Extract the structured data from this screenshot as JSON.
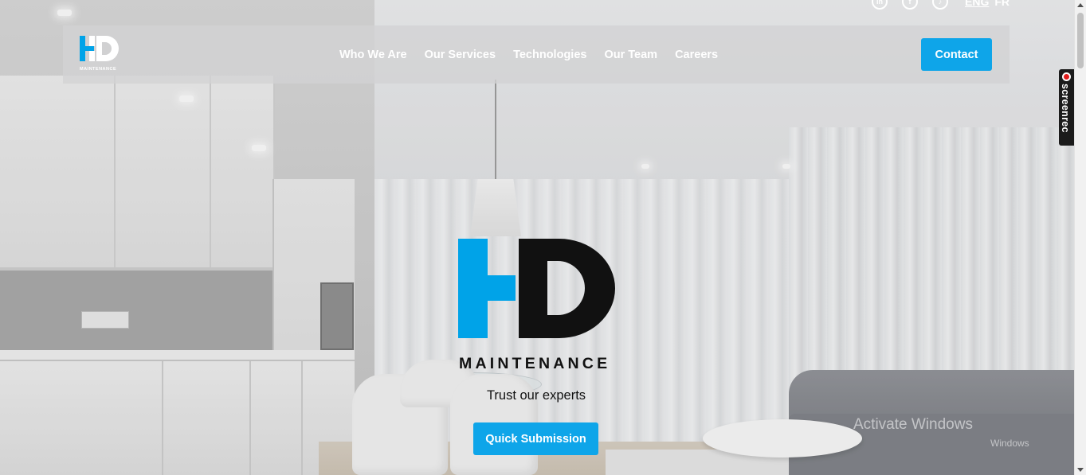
{
  "brand": {
    "name": "HD",
    "subtitle": "MAINTENANCE",
    "colors": {
      "accent": "#0ea5e9",
      "logo_blue": "#00a3e8",
      "logo_dark": "#111111"
    }
  },
  "top_bar": {
    "social": [
      {
        "icon": "linkedin-icon",
        "glyph": "in"
      },
      {
        "icon": "facebook-icon",
        "glyph": "f"
      },
      {
        "icon": "tiktok-icon",
        "glyph": "♪"
      }
    ],
    "languages": {
      "active": "ENG",
      "other": "FR"
    }
  },
  "nav": {
    "links": [
      "Who We Are",
      "Our Services",
      "Technologies",
      "Our Team",
      "Careers"
    ],
    "contact_label": "Contact"
  },
  "hero": {
    "logo_word": "MAINTENANCE",
    "tagline": "Trust our experts",
    "cta_label": "Quick Submission"
  },
  "overlay": {
    "screenrec_label": "screenrec",
    "watermark_title": "Activate Windows",
    "watermark_sub": "Windows"
  }
}
